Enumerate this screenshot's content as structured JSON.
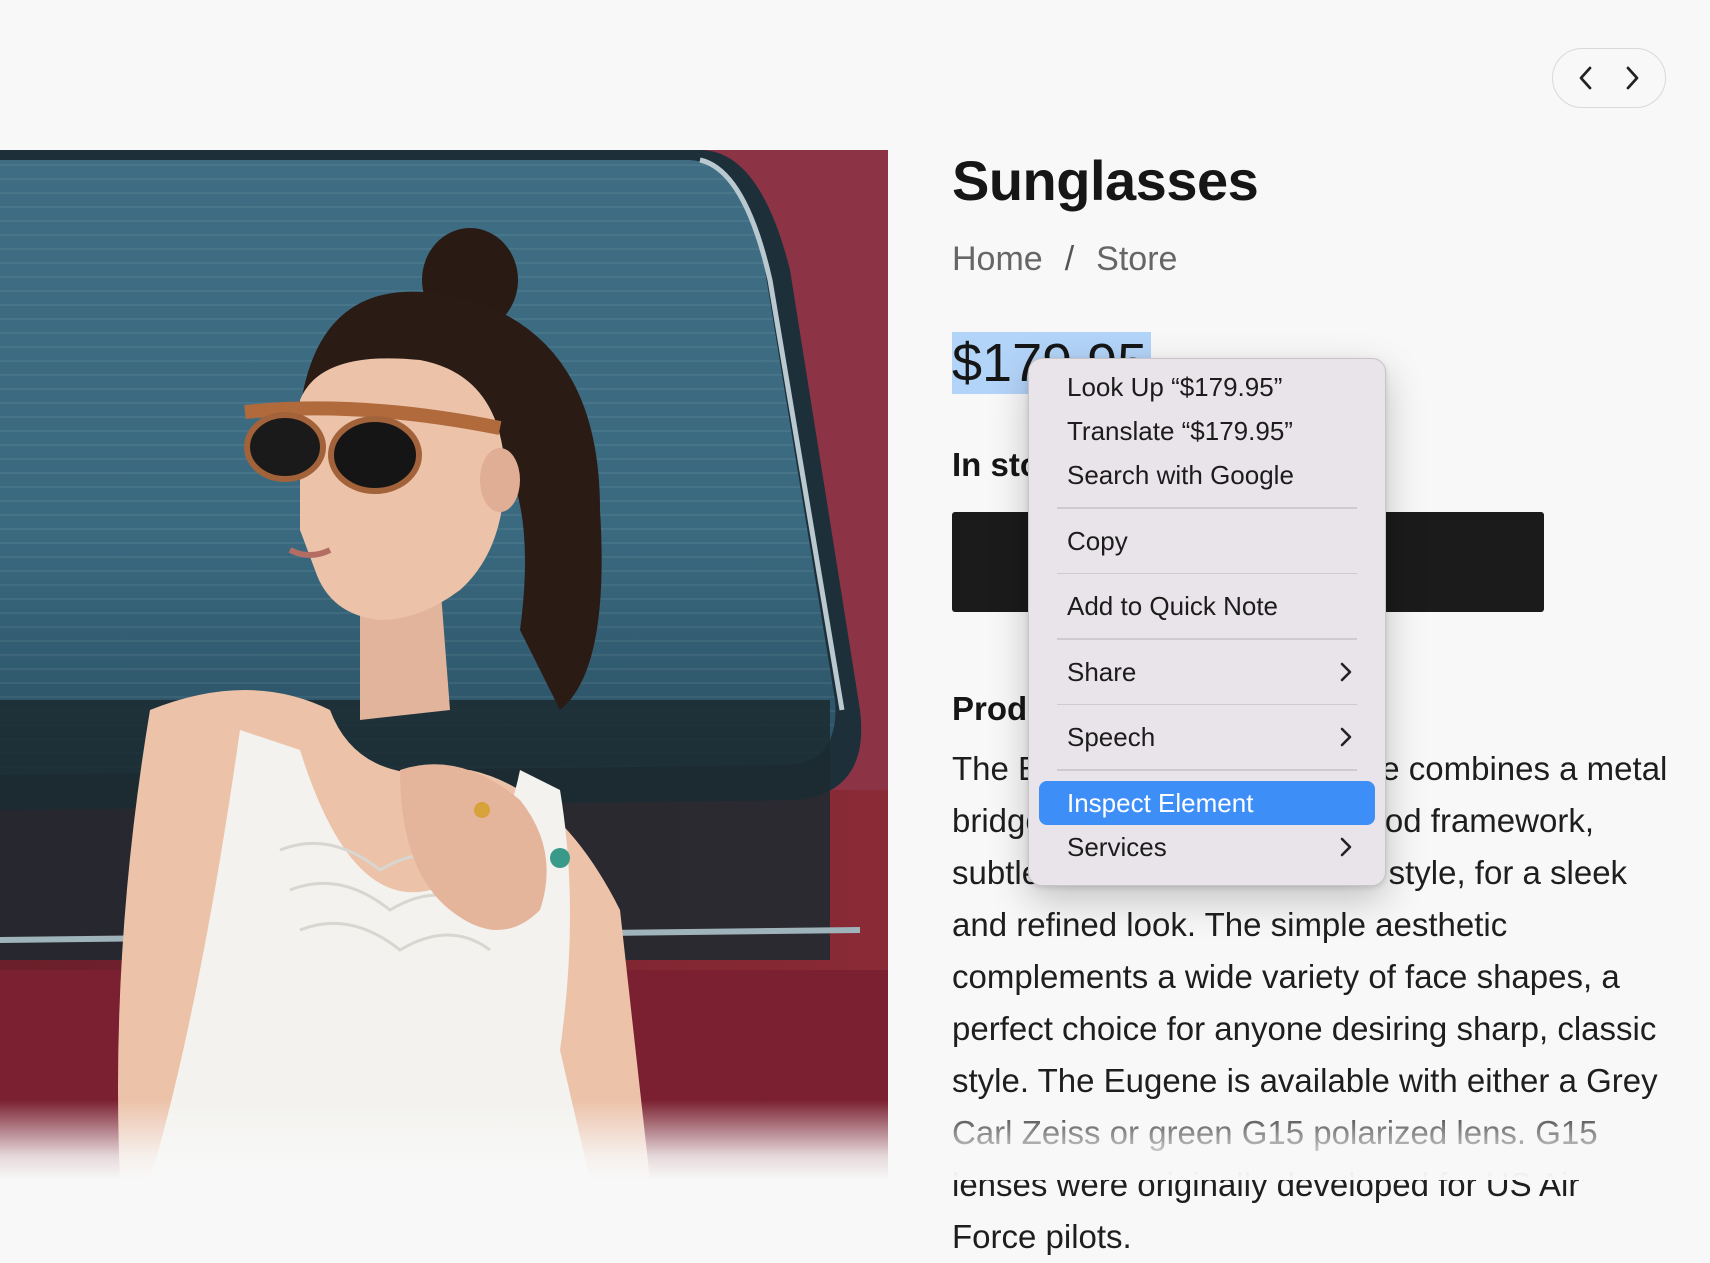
{
  "nav": {
    "prev_icon": "chevron-left-icon",
    "next_icon": "chevron-right-icon"
  },
  "product": {
    "title": "Sunglasses",
    "breadcrumb": {
      "home": "Home",
      "separator": "/",
      "store": "Store"
    },
    "price": "$179.95",
    "stock_label": "In stock",
    "section_title": "Product Details",
    "description": "The Eugene sunglasses frame combines a metal bridge with a hand-crafted wood framework, subtle hardware and a ladder style, for a sleek and refined look. The simple aesthetic complements a wide variety of face shapes, a perfect choice for anyone desiring sharp, classic style. The Eugene is available with either a Grey Carl Zeiss or green G15 polarized lens. G15 lenses were originally developed for US Air Force pilots."
  },
  "context_menu": {
    "items": [
      {
        "label": "Look Up “$179.95”",
        "submenu": false
      },
      {
        "label": "Translate “$179.95”",
        "submenu": false
      },
      {
        "label": "Search with Google",
        "submenu": false
      },
      {
        "label": "Copy",
        "submenu": false
      },
      {
        "label": "Add to Quick Note",
        "submenu": false
      },
      {
        "label": "Share",
        "submenu": true
      },
      {
        "label": "Speech",
        "submenu": true
      },
      {
        "label": "Inspect Element",
        "submenu": false,
        "highlighted": true
      },
      {
        "label": "Services",
        "submenu": true
      }
    ]
  },
  "colors": {
    "page_bg": "#f8f8f8",
    "selection_highlight": "#b3d4f9",
    "menu_bg": "#e9e4e9",
    "menu_active": "#3d8ef7",
    "button_bg": "#1b1b1b"
  }
}
